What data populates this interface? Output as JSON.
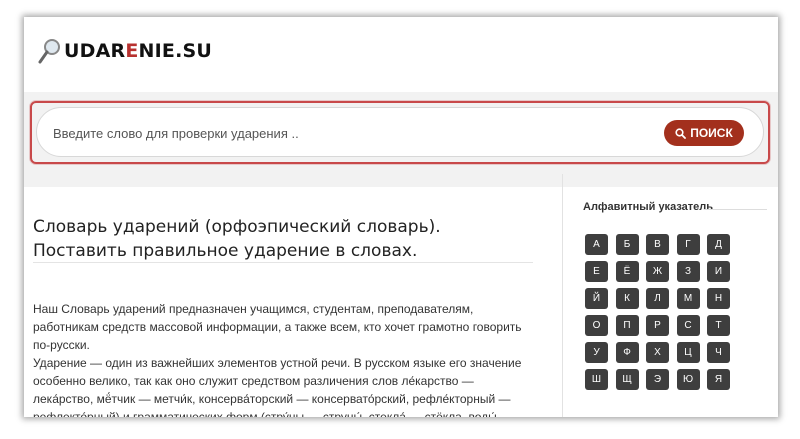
{
  "brand": {
    "prefix": "UDAR",
    "accent": "E",
    "suffix": "NIE.SU",
    "accent_color": "#b8312f"
  },
  "search": {
    "placeholder": "Введите слово для проверки ударения ..",
    "button_label": "ПОИСК",
    "button_color": "#a3301d",
    "highlight_color": "#c8494a"
  },
  "main": {
    "title": "Словарь ударений (орфоэпический словарь). Поставить правильное ударение в словах.",
    "paragraphs": [
      "Наш Словарь ударений предназначен учащимся, студентам, преподавателям, работникам средств массовой информации, а также всем, кто хочет грамотно говорить по-русски.",
      "Ударение — один из важнейших элементов устной речи. В русском языке его значение особенно велико, так как оно служит средством различения слов ле́карство — лека́рство, мё́тчик — метчи́к, консерва́торский — консервато́рский, рефле́кторный — рефлекто́рный) и грамматических форм (стру́ны — струны́, стекла́ — стёкла, воды́ — во́ды)."
    ]
  },
  "sidebar": {
    "title": "Алфавитный указатель",
    "letters": [
      "А",
      "Б",
      "В",
      "Г",
      "Д",
      "Е",
      "Ё",
      "Ж",
      "З",
      "И",
      "Й",
      "К",
      "Л",
      "М",
      "Н",
      "О",
      "П",
      "Р",
      "С",
      "Т",
      "У",
      "Ф",
      "Х",
      "Ц",
      "Ч",
      "Ш",
      "Щ",
      "Э",
      "Ю",
      "Я"
    ]
  },
  "icons": {
    "logo": "magnifier-icon",
    "search_button": "search-icon"
  }
}
